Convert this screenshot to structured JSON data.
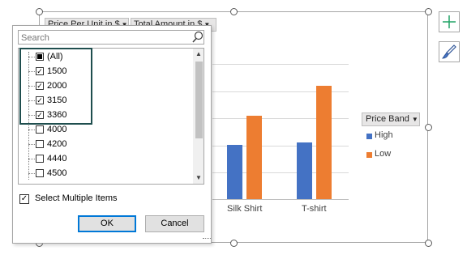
{
  "chart": {
    "field_buttons": [
      {
        "label": "Price Per Unit in $"
      },
      {
        "label": "Total Amount in $"
      }
    ],
    "legend": {
      "title": "Price Band",
      "items": [
        {
          "label": "High",
          "color": "#4472c4"
        },
        {
          "label": "Low",
          "color": "#ed7d31"
        }
      ]
    },
    "categories": [
      "Silk Shirt",
      "T-shirt"
    ]
  },
  "chart_data": {
    "type": "bar",
    "categories": [
      "Silk Shirt",
      "T-shirt"
    ],
    "series": [
      {
        "name": "High",
        "color": "#4472c4",
        "values": [
          2,
          2.1
        ]
      },
      {
        "name": "Low",
        "color": "#ed7d31",
        "values": [
          3.1,
          4.2
        ]
      }
    ],
    "ylim": [
      0,
      6
    ],
    "grid": true,
    "legend_position": "right"
  },
  "side_buttons": [
    {
      "icon": "plus-icon"
    },
    {
      "icon": "paintbrush-icon"
    }
  ],
  "filter_popup": {
    "search_placeholder": "Search",
    "items": [
      {
        "label": "(All)",
        "state": "partial"
      },
      {
        "label": "1500",
        "state": "checked"
      },
      {
        "label": "2000",
        "state": "checked"
      },
      {
        "label": "3150",
        "state": "checked"
      },
      {
        "label": "3360",
        "state": "checked"
      },
      {
        "label": "4000",
        "state": "unchecked"
      },
      {
        "label": "4200",
        "state": "unchecked"
      },
      {
        "label": "4440",
        "state": "unchecked"
      },
      {
        "label": "4500",
        "state": "unchecked"
      }
    ],
    "select_multiple_label": "Select Multiple Items",
    "select_multiple_checked": true,
    "ok_label": "OK",
    "cancel_label": "Cancel"
  }
}
